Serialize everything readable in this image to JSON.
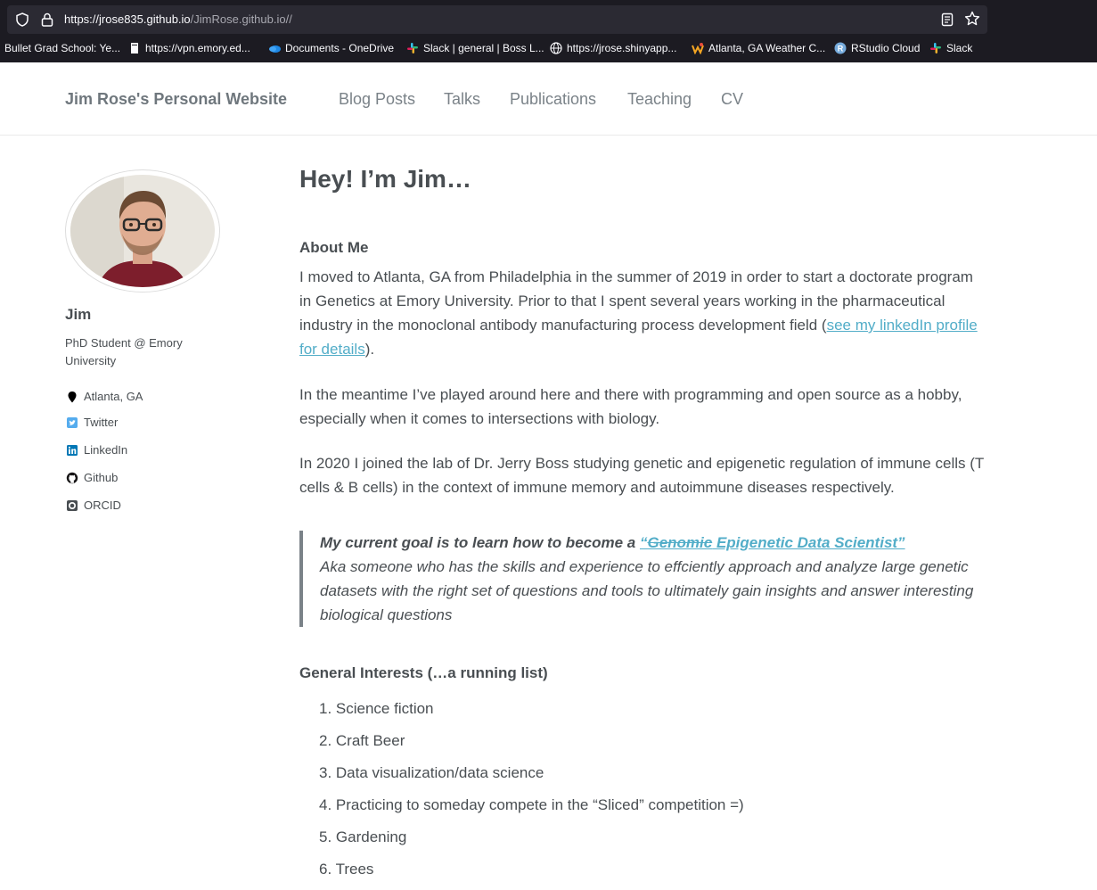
{
  "browser": {
    "url_host": "https://jrose835.github.io",
    "url_path": "/JimRose.github.io//",
    "bookmarks": [
      {
        "label": "Bullet Grad School: Ye...",
        "icon": "none"
      },
      {
        "label": "https://vpn.emory.ed...",
        "icon": "page-icon"
      },
      {
        "label": "Documents - OneDrive",
        "icon": "onedrive-icon"
      },
      {
        "label": "Slack | general | Boss L...",
        "icon": "slack-icon"
      },
      {
        "label": "https://jrose.shinyapp...",
        "icon": "globe-icon"
      },
      {
        "label": "Atlanta, GA Weather C...",
        "icon": "weather-icon"
      },
      {
        "label": "RStudio Cloud",
        "icon": "rstudio-icon"
      },
      {
        "label": "Slack",
        "icon": "slack-icon"
      }
    ]
  },
  "header": {
    "site_title": "Jim Rose's Personal Website",
    "nav": [
      "Blog Posts",
      "Talks",
      "Publications",
      "Teaching",
      "CV"
    ]
  },
  "sidebar": {
    "name": "Jim",
    "bio": "PhD Student @ Emory University",
    "links": [
      {
        "label": "Atlanta, GA",
        "icon": "map-marker-icon"
      },
      {
        "label": "Twitter",
        "icon": "twitter-icon"
      },
      {
        "label": "LinkedIn",
        "icon": "linkedin-icon"
      },
      {
        "label": "Github",
        "icon": "github-icon"
      },
      {
        "label": "ORCID",
        "icon": "orcid-icon"
      }
    ]
  },
  "main": {
    "title": "Hey! I’m Jim…",
    "about_heading": "About Me",
    "about_p1_before": "I moved to Atlanta, GA from Philadelphia in the summer of 2019 in order to start a doctorate program in Genetics at Emory University. Prior to that I spent several years working in the pharmaceutical industry in the monoclonal antibody manufacturing process development field (",
    "about_p1_link": "see my linkedIn profile for details",
    "about_p1_after": ").",
    "about_p2": "In the meantime I’ve played around here and there with programming and open source as a hobby, especially when it comes to intersections with biology.",
    "about_p3": "In 2020 I joined the lab of Dr. Jerry Boss studying genetic and epigenetic regulation of immune cells (T cells & B cells) in the context of immune memory and autoimmune diseases respectively.",
    "quote_goal_prefix": "My current goal is to learn how to become a ",
    "quote_link_open": "“",
    "quote_link_struck": "Genomic",
    "quote_link_rest": " Epigenetic Data Scientist”",
    "quote_body": "Aka someone who has the skills and experience to effciently approach and analyze large genetic datasets with the right set of questions and tools to ultimately gain insights and answer interesting biological questions",
    "interests_heading": "General Interests (…a running list)",
    "interests": [
      "1. Science fiction",
      "2. Craft Beer",
      "3. Data visualization/data science",
      "4. Practicing to someday compete in the “Sliced” competition =)",
      "5. Gardening",
      "6. Trees"
    ]
  }
}
